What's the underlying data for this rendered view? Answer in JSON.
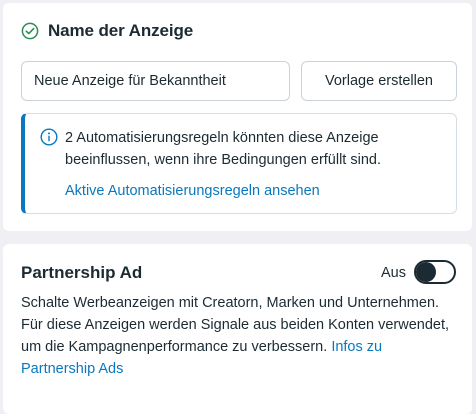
{
  "ad_name_section": {
    "title": "Name der Anzeige",
    "status_icon": "check-circle-icon",
    "name_input": {
      "value": "Neue Anzeige für Bekanntheit",
      "placeholder": ""
    },
    "template_button_label": "Vorlage erstellen",
    "info": {
      "icon": "info-icon",
      "text": "2 Automatisierungsregeln könnten diese Anzeige beeinflussen, wenn ihre Bedingungen erfüllt sind.",
      "link_label": "Aktive Automatisierungsregeln ansehen"
    }
  },
  "partnership_section": {
    "title": "Partnership Ad",
    "toggle": {
      "label": "Aus",
      "on": false
    },
    "description": "Schalte Werbeanzeigen mit Creatorn, Marken und Unternehmen. Für diese Anzeigen werden Signale aus beiden Konten verwendet, um die Kampagnenperformance zu verbessern. ",
    "link_label": "Infos zu Partnership Ads"
  },
  "colors": {
    "accent": "#0a78be",
    "success": "#2e8b57",
    "text": "#1c2b33",
    "background": "#f0eff4"
  }
}
